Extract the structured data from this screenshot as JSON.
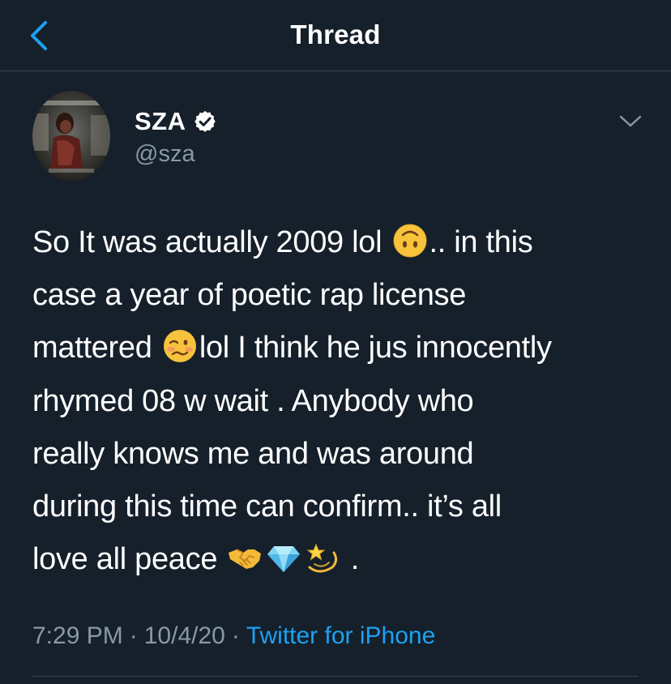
{
  "nav": {
    "title": "Thread"
  },
  "author": {
    "display_name": "SZA",
    "handle": "@sza",
    "verified": true
  },
  "tweet": {
    "lines": [
      [
        "So It was actually 2009 lol ",
        "{upside-down-face}",
        ".. in this"
      ],
      [
        "case a year of poetic rap license"
      ],
      [
        "mattered ",
        "{woozy-face}",
        "lol I think he jus innocently"
      ],
      [
        "rhymed 08 w wait . Anybody who"
      ],
      [
        "really knows me and was around"
      ],
      [
        "during this time can confirm.. it’s all"
      ],
      [
        "love all peace ",
        "{handshake}",
        "{gem}",
        "{dizzy}",
        " ."
      ]
    ],
    "line_1_a": "So It was actually 2009 lol ",
    "line_1_b": ".. in this",
    "line_2": "case a year of poetic rap license",
    "line_3_a": "mattered ",
    "line_3_b": "lol I think he jus innocently",
    "line_4": "rhymed 08 w wait . Anybody who",
    "line_5": "really knows me and was around",
    "line_6": "during this time can confirm.. it’s all",
    "line_7_a": "love all peace ",
    "line_7_b": " ."
  },
  "meta": {
    "time": "7:29 PM",
    "separator": "·",
    "date": "10/4/20",
    "source": "Twitter for iPhone"
  },
  "icons": {
    "back": "chevron-left-icon",
    "verified": "verified-badge-icon",
    "more": "chevron-down-icon",
    "emoji_1": "upside-down-face-emoji",
    "emoji_2": "woozy-face-emoji",
    "emoji_3": "handshake-emoji",
    "emoji_4": "gem-stone-emoji",
    "emoji_5": "dizzy-emoji"
  },
  "colors": {
    "background": "#15202b",
    "accent": "#1da1f2",
    "secondary_text": "#8899a6",
    "divider": "#38444d"
  }
}
